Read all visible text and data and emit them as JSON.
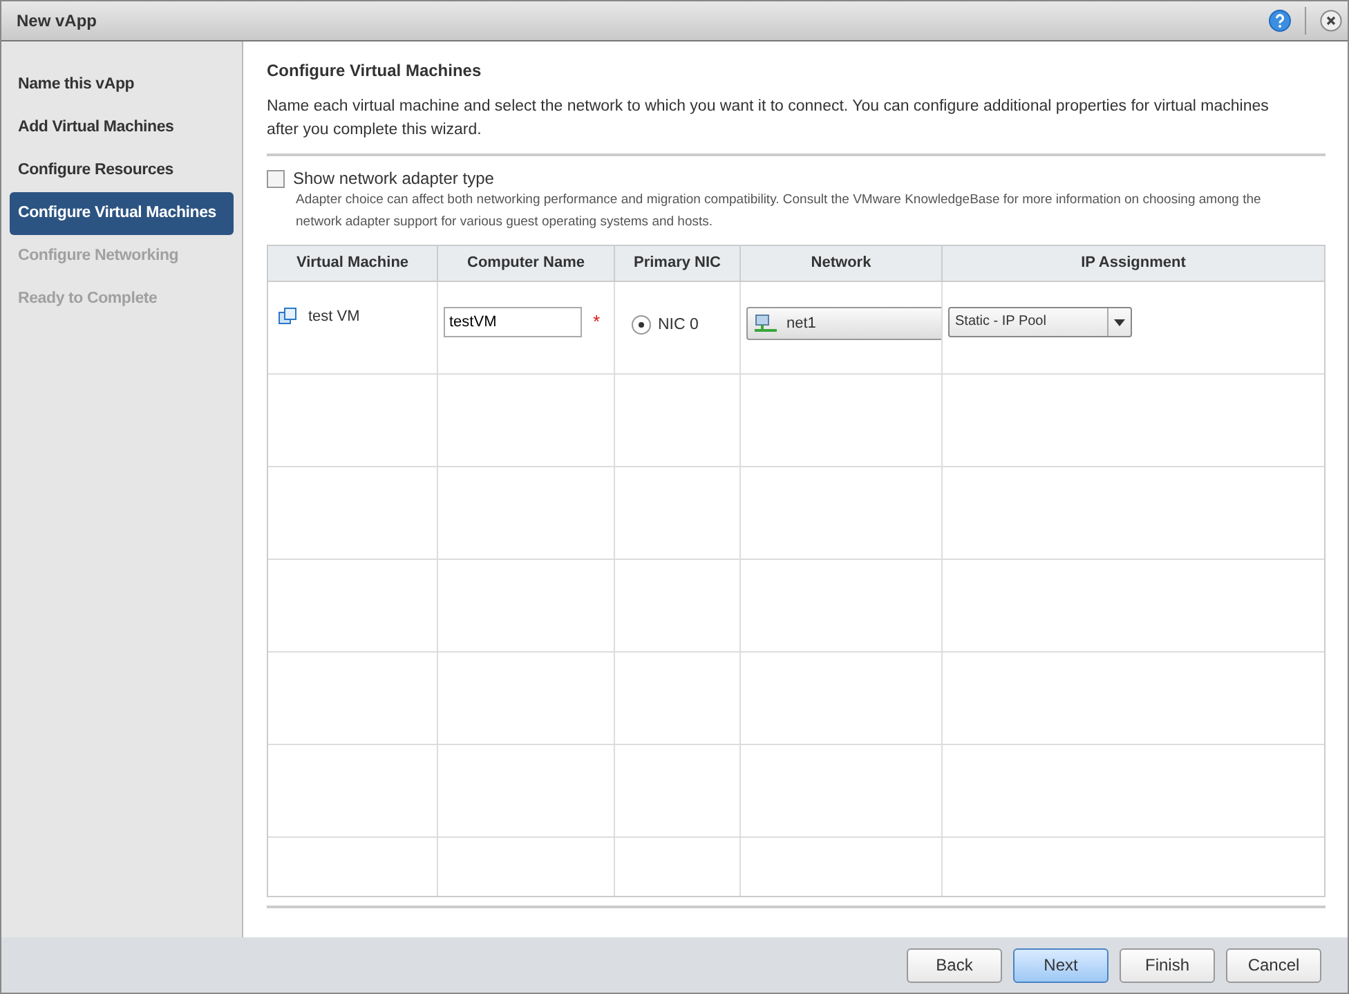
{
  "window": {
    "title": "New vApp"
  },
  "steps": [
    {
      "label": "Name this vApp",
      "selected": false,
      "disabled": false
    },
    {
      "label": "Add Virtual Machines",
      "selected": false,
      "disabled": false
    },
    {
      "label": "Configure Resources",
      "selected": false,
      "disabled": false
    },
    {
      "label": "Configure Virtual Machines",
      "selected": true,
      "disabled": false
    },
    {
      "label": "Configure Networking",
      "selected": false,
      "disabled": true
    },
    {
      "label": "Ready to Complete",
      "selected": false,
      "disabled": true
    }
  ],
  "page": {
    "title": "Configure Virtual Machines",
    "description": "Name each virtual machine and select the network to which you want it to connect. You can configure additional properties for virtual machines after you complete this wizard."
  },
  "adapter_option": {
    "label": "Show network adapter type",
    "checked": false,
    "hint": "Adapter choice can affect both networking performance and migration compatibility. Consult the VMware KnowledgeBase for more information on choosing among the network adapter support for various guest operating systems and hosts."
  },
  "table": {
    "columns": [
      "Virtual Machine",
      "Computer Name",
      "Primary NIC",
      "Network",
      "IP Assignment"
    ],
    "rows": [
      {
        "vm": "test VM",
        "computer_name": "testVM",
        "required": "*",
        "nic": "NIC 0",
        "nic_selected": true,
        "network": "net1",
        "ip_assignment": "Static - IP Pool"
      }
    ]
  },
  "buttons": [
    {
      "label": "Back",
      "primary": false
    },
    {
      "label": "Next",
      "primary": true
    },
    {
      "label": "Finish",
      "primary": false
    },
    {
      "label": "Cancel",
      "primary": false
    }
  ]
}
